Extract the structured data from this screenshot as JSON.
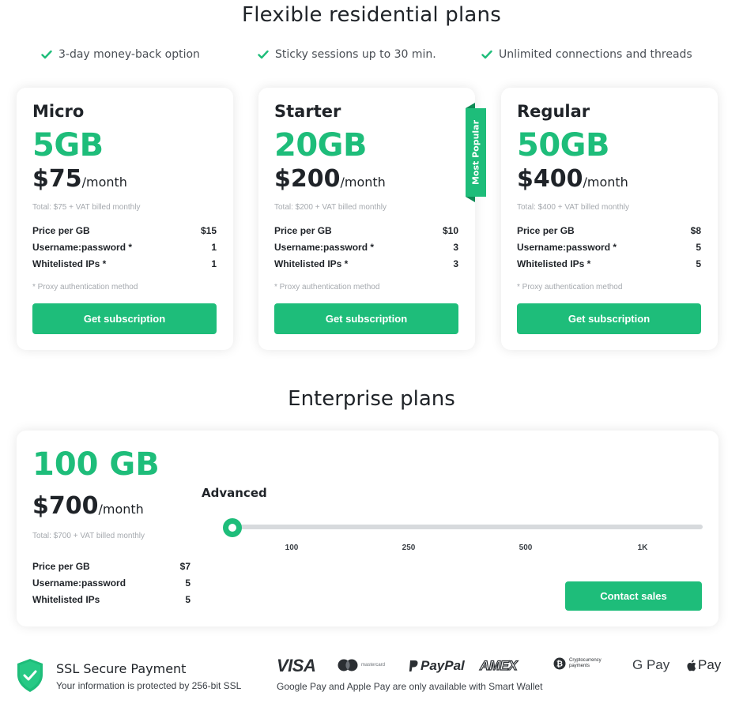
{
  "title": "Flexible residential plans",
  "features": [
    "3-day money-back option",
    "Sticky sessions up to 30 min.",
    "Unlimited connections and threads"
  ],
  "spec_labels": {
    "price_per_gb": "Price per GB",
    "userpass": "Username:password *",
    "ips": "Whitelisted IPs *"
  },
  "plan_note": "* Proxy authentication method",
  "plans": [
    {
      "name": "Micro",
      "gb": "5GB",
      "price": "$75",
      "per": "/month",
      "total": "Total: $75 + VAT billed monthly",
      "price_per_gb": "$15",
      "userpass": "1",
      "ips": "1",
      "button": "Get subscription"
    },
    {
      "name": "Starter",
      "gb": "20GB",
      "price": "$200",
      "per": "/month",
      "total": "Total: $200 + VAT billed monthly",
      "price_per_gb": "$10",
      "userpass": "3",
      "ips": "3",
      "button": "Get subscription",
      "badge": "Most Popular"
    },
    {
      "name": "Regular",
      "gb": "50GB",
      "price": "$400",
      "per": "/month",
      "total": "Total: $400 + VAT billed monthly",
      "price_per_gb": "$8",
      "userpass": "5",
      "ips": "5",
      "button": "Get subscription"
    }
  ],
  "enterprise": {
    "title": "Enterprise plans",
    "gb": "100 GB",
    "price": "$700",
    "per": "/month",
    "total": "Total: $700 + VAT billed monthly",
    "tier": "Advanced",
    "labels": {
      "price_per_gb": "Price per GB",
      "userpass": "Username:password",
      "ips": "Whitelisted IPs"
    },
    "price_per_gb": "$7",
    "userpass": "5",
    "ips": "5",
    "ticks": [
      "100",
      "250",
      "500",
      "1K"
    ],
    "slider_value": "100",
    "button": "Contact sales"
  },
  "ssl": {
    "title": "SSL Secure Payment",
    "text": "Your information is protected by 256-bit SSL"
  },
  "payments": {
    "visa": "VISA",
    "mastercard": "mastercard",
    "paypal": "PayPal",
    "amex": "AMEX",
    "crypto": "Cryptocurrency payments",
    "gpay": "G Pay",
    "applepay": "Pay",
    "note": "Google Pay and Apple Pay are only available with Smart Wallet"
  },
  "colors": {
    "accent": "#1ebd7a",
    "ribbon_dark": "#0f8a55",
    "text": "#1f2328",
    "muted": "#a5a9ae"
  }
}
